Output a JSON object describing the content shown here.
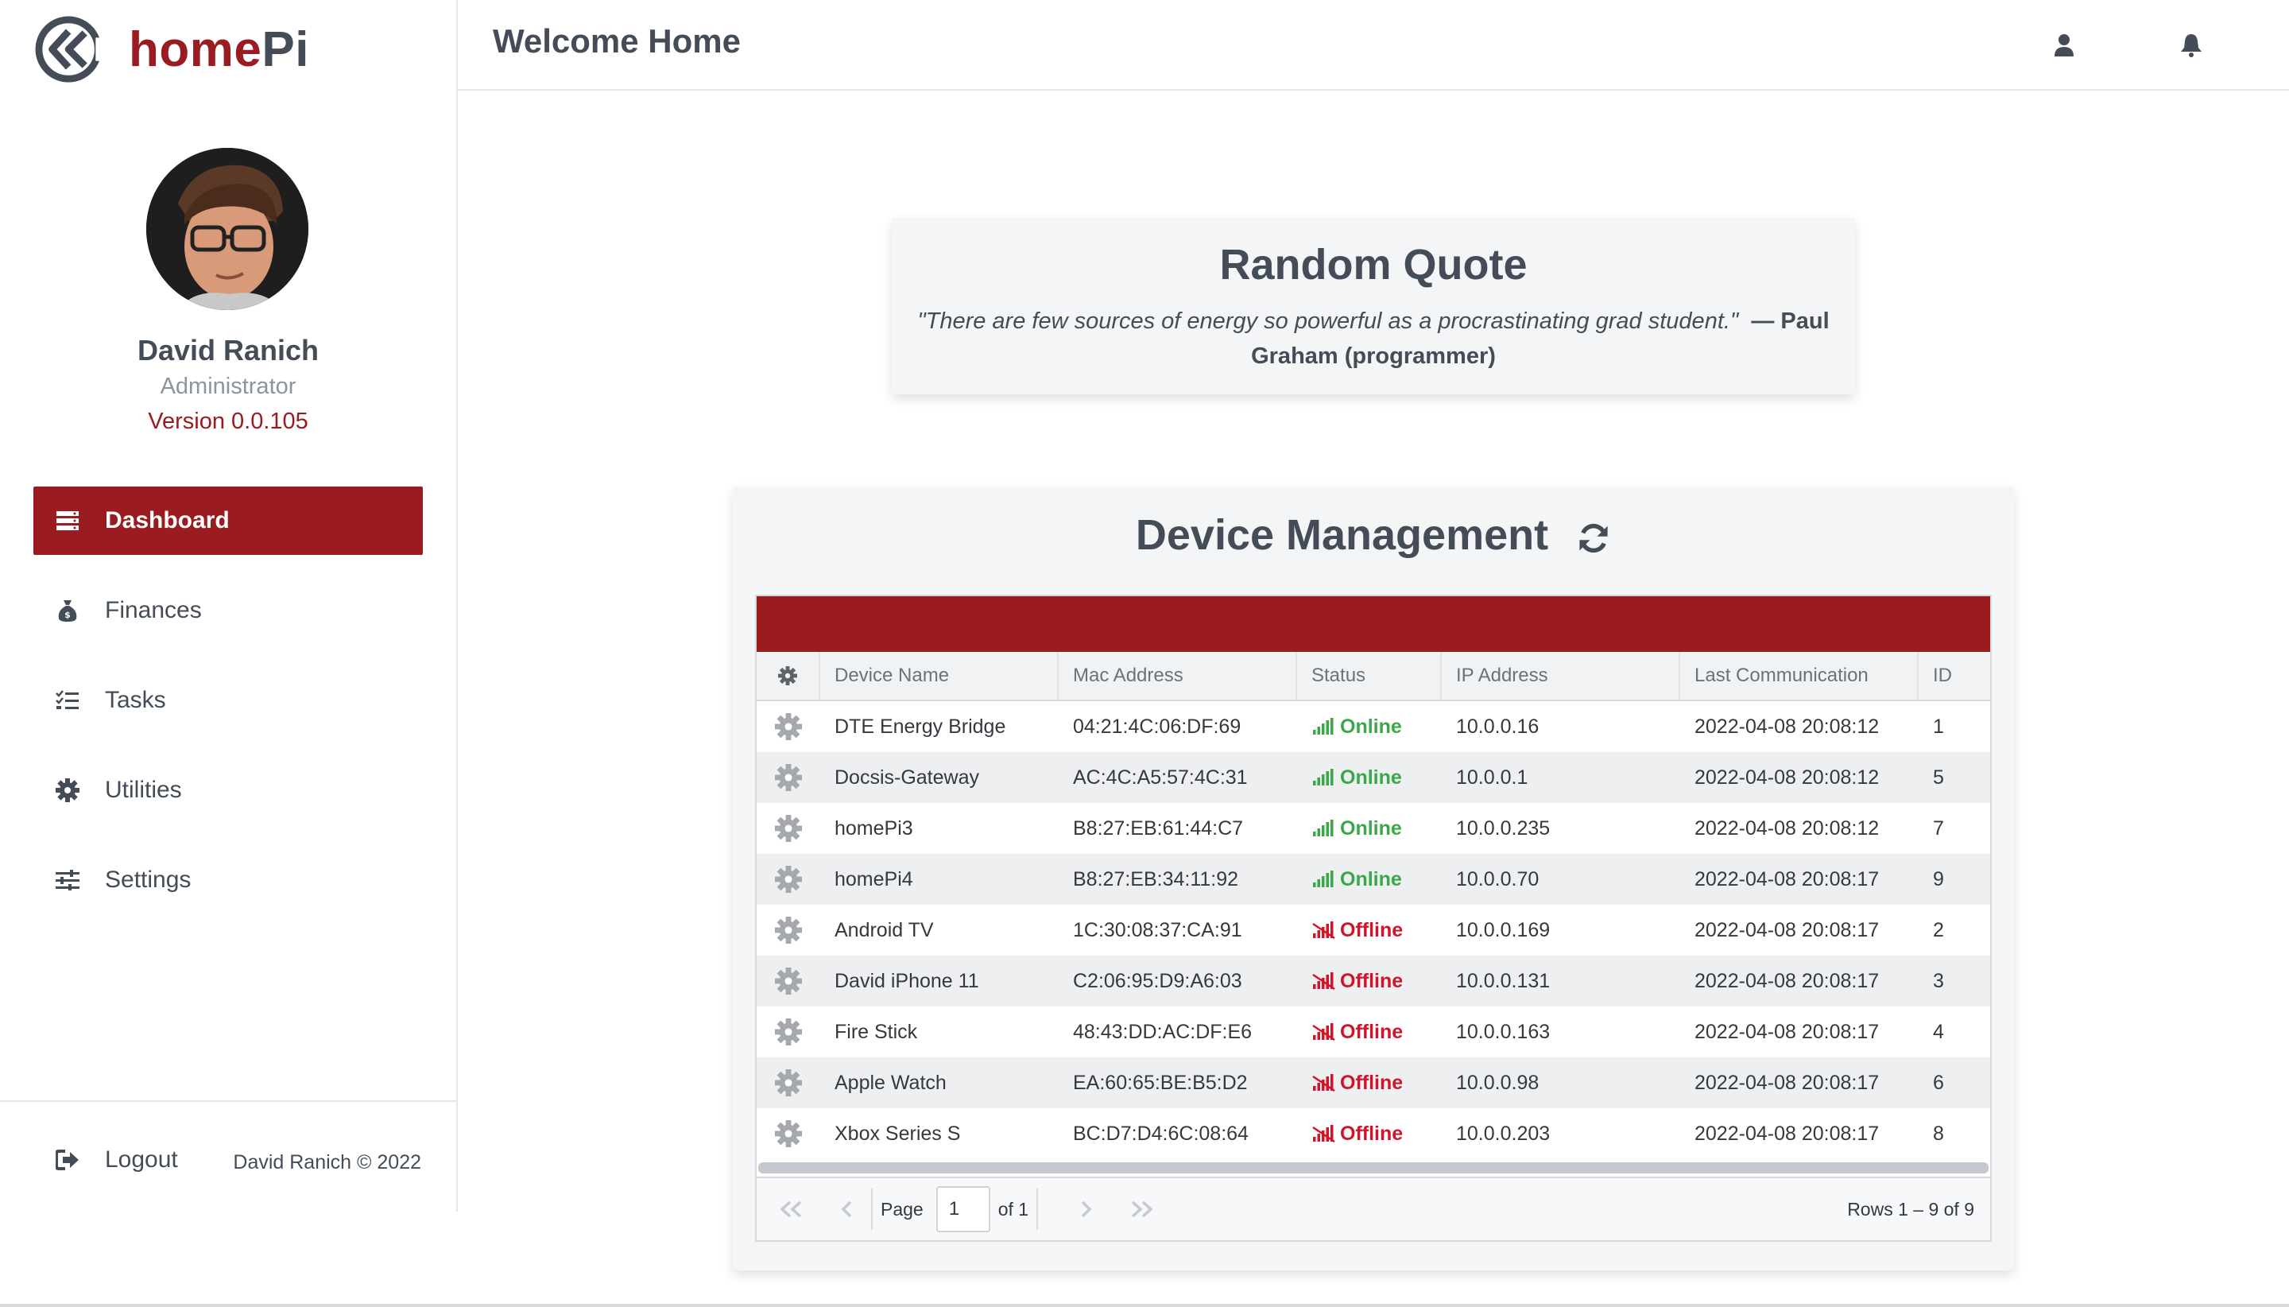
{
  "app": {
    "brand_home": "home",
    "brand_pi": "Pi"
  },
  "header": {
    "title": "Welcome Home"
  },
  "profile": {
    "name": "David Ranich",
    "role": "Administrator",
    "version": "Version 0.0.105"
  },
  "nav": {
    "items": [
      {
        "label": "Dashboard",
        "icon": "server-icon",
        "active": true
      },
      {
        "label": "Finances",
        "icon": "money-bag-icon"
      },
      {
        "label": "Tasks",
        "icon": "task-list-icon"
      },
      {
        "label": "Utilities",
        "icon": "gear-icon"
      },
      {
        "label": "Settings",
        "icon": "sliders-icon"
      }
    ]
  },
  "footer": {
    "logout": "Logout",
    "copyright": "David Ranich © 2022"
  },
  "quote": {
    "title": "Random Quote",
    "text": "\"There are few sources of energy so powerful as a procrastinating grad student.\"",
    "author": "— Paul Graham (programmer)"
  },
  "devices": {
    "title": "Device Management",
    "columns": [
      "Device Name",
      "Mac Address",
      "Status",
      "IP Address",
      "Last Communication",
      "ID"
    ],
    "rows": [
      {
        "name": "DTE Energy Bridge",
        "mac": "04:21:4C:06:DF:69",
        "status": "Online",
        "ip": "10.0.0.16",
        "last": "2022-04-08 20:08:12",
        "id": "1"
      },
      {
        "name": "Docsis-Gateway",
        "mac": "AC:4C:A5:57:4C:31",
        "status": "Online",
        "ip": "10.0.0.1",
        "last": "2022-04-08 20:08:12",
        "id": "5"
      },
      {
        "name": "homePi3",
        "mac": "B8:27:EB:61:44:C7",
        "status": "Online",
        "ip": "10.0.0.235",
        "last": "2022-04-08 20:08:12",
        "id": "7"
      },
      {
        "name": "homePi4",
        "mac": "B8:27:EB:34:11:92",
        "status": "Online",
        "ip": "10.0.0.70",
        "last": "2022-04-08 20:08:17",
        "id": "9"
      },
      {
        "name": "Android TV",
        "mac": "1C:30:08:37:CA:91",
        "status": "Offline",
        "ip": "10.0.0.169",
        "last": "2022-04-08 20:08:17",
        "id": "2"
      },
      {
        "name": "David iPhone 11",
        "mac": "C2:06:95:D9:A6:03",
        "status": "Offline",
        "ip": "10.0.0.131",
        "last": "2022-04-08 20:08:17",
        "id": "3"
      },
      {
        "name": "Fire Stick",
        "mac": "48:43:DD:AC:DF:E6",
        "status": "Offline",
        "ip": "10.0.0.163",
        "last": "2022-04-08 20:08:17",
        "id": "4"
      },
      {
        "name": "Apple Watch",
        "mac": "EA:60:65:BE:B5:D2",
        "status": "Offline",
        "ip": "10.0.0.98",
        "last": "2022-04-08 20:08:17",
        "id": "6"
      },
      {
        "name": "Xbox Series S",
        "mac": "BC:D7:D4:6C:08:64",
        "status": "Offline",
        "ip": "10.0.0.203",
        "last": "2022-04-08 20:08:17",
        "id": "8"
      }
    ],
    "pager": {
      "page_label": "Page",
      "page_value": "1",
      "of_label": "of 1",
      "rows_info": "Rows 1 – 9 of 9"
    }
  },
  "colors": {
    "brand": "#9b1c20",
    "text": "#434c57",
    "online": "#3aa847",
    "offline": "#d0142a"
  }
}
